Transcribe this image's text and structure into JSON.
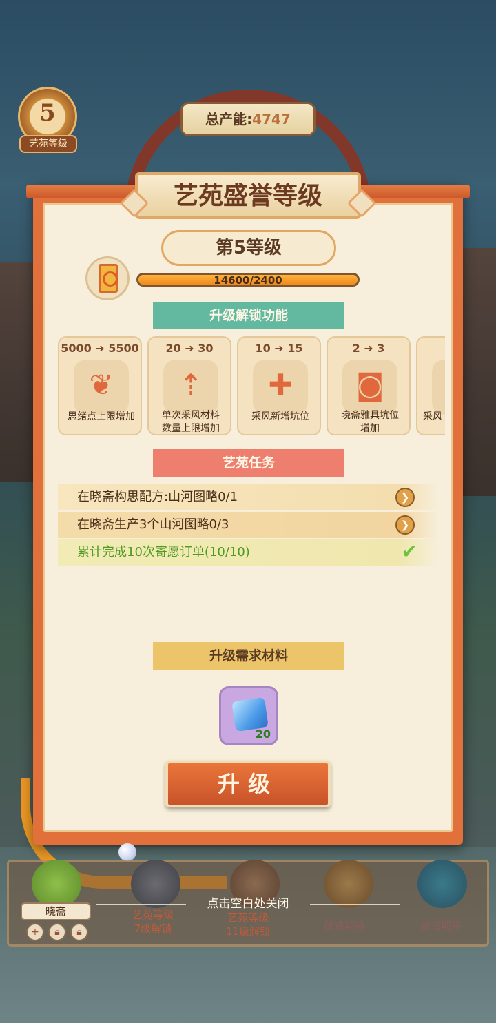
{
  "hud": {
    "level_number": "5",
    "level_label": "艺苑等级",
    "total_power_label": "总产能:",
    "total_power_value": "4747"
  },
  "dialog": {
    "title": "艺苑盛誉等级",
    "rank": "第5等级",
    "progress_text": "14600/2400",
    "progress_fraction": 1.0,
    "unlock_header": "升级解锁功能",
    "features": [
      {
        "range": "5000 ➜ 5500",
        "icon": "ink-scroll-icon",
        "name": "思绪点上限增加"
      },
      {
        "range": "20 ➜ 30",
        "icon": "bird-arrow-icon",
        "name": "单次采风材料\n数量上限增加"
      },
      {
        "range": "10 ➜ 15",
        "icon": "bird-plus-icon",
        "name": "采风新增坑位"
      },
      {
        "range": "2 ➜ 3",
        "icon": "banner-icon",
        "name": "晓斋雅具坑位\n增加"
      },
      {
        "range": "",
        "icon": "gem-icon",
        "name": "采风"
      }
    ],
    "task_header": "艺苑任务",
    "tasks": [
      {
        "text": "在晓斋构思配方:山河图略0/1",
        "status": "go"
      },
      {
        "text": "在晓斋生产3个山河图略0/3",
        "status": "go"
      },
      {
        "text": "累计完成10次寄愿订单(10/10)",
        "status": "done"
      }
    ],
    "material_header": "升级需求材料",
    "material": {
      "icon": "ice-cube-icon",
      "count": "20"
    },
    "upgrade_button": "升级"
  },
  "bottom": {
    "close_hint": "点击空白处关闭",
    "slots": [
      {
        "name": "晓斋",
        "icon": "parrot-icon"
      },
      {
        "line1": "艺苑等级",
        "line2": "7级解锁",
        "icon": "crow-icon"
      },
      {
        "line1": "艺苑等级",
        "line2": "11级解锁",
        "icon": "sparrow-icon"
      },
      {
        "line1": "敬请期待",
        "icon": "owl-icon"
      },
      {
        "line1": "敬请期待",
        "icon": "peacock-icon"
      }
    ]
  },
  "colors": {
    "accent_orange": "#e2703a",
    "teal_ribbon": "#63b8a0",
    "red_ribbon": "#ee7f6e",
    "gold_ribbon": "#ecc46a",
    "done_green": "#4f9a22"
  }
}
